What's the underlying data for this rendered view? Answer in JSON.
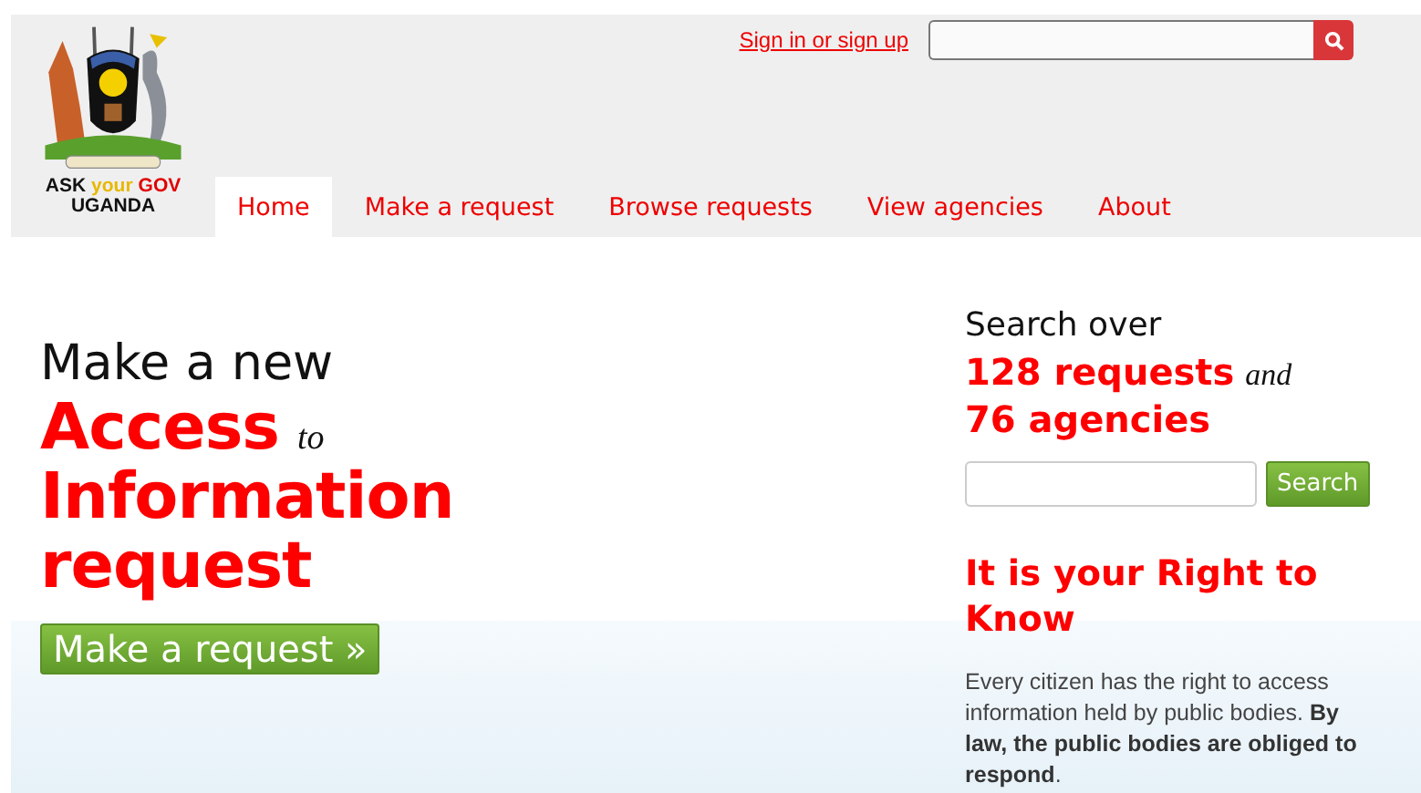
{
  "header": {
    "logo": {
      "words": [
        {
          "text": "ASK",
          "color": "#111111"
        },
        {
          "text": "your",
          "color": "#e8b800"
        },
        {
          "text": "GOV",
          "color": "#e00000"
        }
      ],
      "subtitle": "UGANDA"
    },
    "account_link": "Sign in or sign up"
  },
  "nav": [
    {
      "label": "Home",
      "selected": true
    },
    {
      "label": "Make a request",
      "selected": false
    },
    {
      "label": "Browse requests",
      "selected": false
    },
    {
      "label": "View agencies",
      "selected": false
    },
    {
      "label": "About",
      "selected": false
    }
  ],
  "hero": {
    "intro": "Make a new",
    "title_part_1": "Access",
    "connector": "to",
    "title_part_2": "Information",
    "title_part_3": "request",
    "button": "Make a request »"
  },
  "sidebar": {
    "search_intro": "Search over",
    "requests_count": "128 requests",
    "connector": "and",
    "agencies_count": "76 agencies",
    "search_button": "Search",
    "heading": "It is your Right to Know",
    "paragraph": "Every citizen has the right to access information held by public bodies. **By law, the public bodies are obliged to respond**."
  }
}
